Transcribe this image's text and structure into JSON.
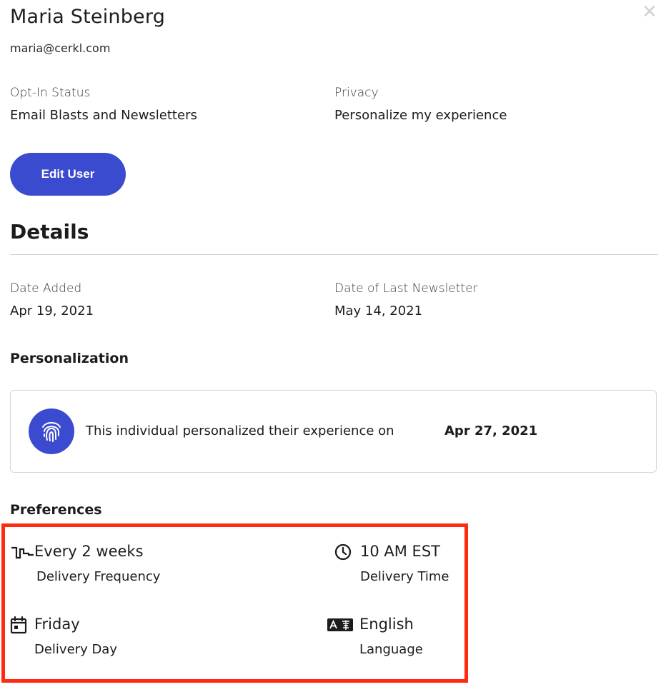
{
  "user": {
    "name": "Maria Steinberg",
    "email": "maria@cerkl.com"
  },
  "close_icon": "close-icon",
  "info": {
    "opt_in_label": "Opt-In Status",
    "opt_in_value": "Email Blasts and Newsletters",
    "privacy_label": "Privacy",
    "privacy_value": "Personalize my experience"
  },
  "edit_button_label": "Edit User",
  "details": {
    "heading": "Details",
    "date_added_label": "Date Added",
    "date_added_value": "Apr 19, 2021",
    "last_newsletter_label": "Date of Last Newsletter",
    "last_newsletter_value": "May 14, 2021"
  },
  "personalization": {
    "heading": "Personalization",
    "text": "This individual personalized their experience on",
    "date": "Apr 27, 2021",
    "icon": "fingerprint-icon"
  },
  "preferences": {
    "heading": "Preferences",
    "frequency_value": "Every 2 weeks",
    "frequency_label": "Delivery Frequency",
    "time_value": "10 AM EST",
    "time_label": "Delivery Time",
    "day_value": "Friday",
    "day_label": "Delivery Day",
    "language_value": "English",
    "language_label": "Language"
  },
  "colors": {
    "accent": "#3b4bd0",
    "highlight_border": "#ff2a12"
  }
}
